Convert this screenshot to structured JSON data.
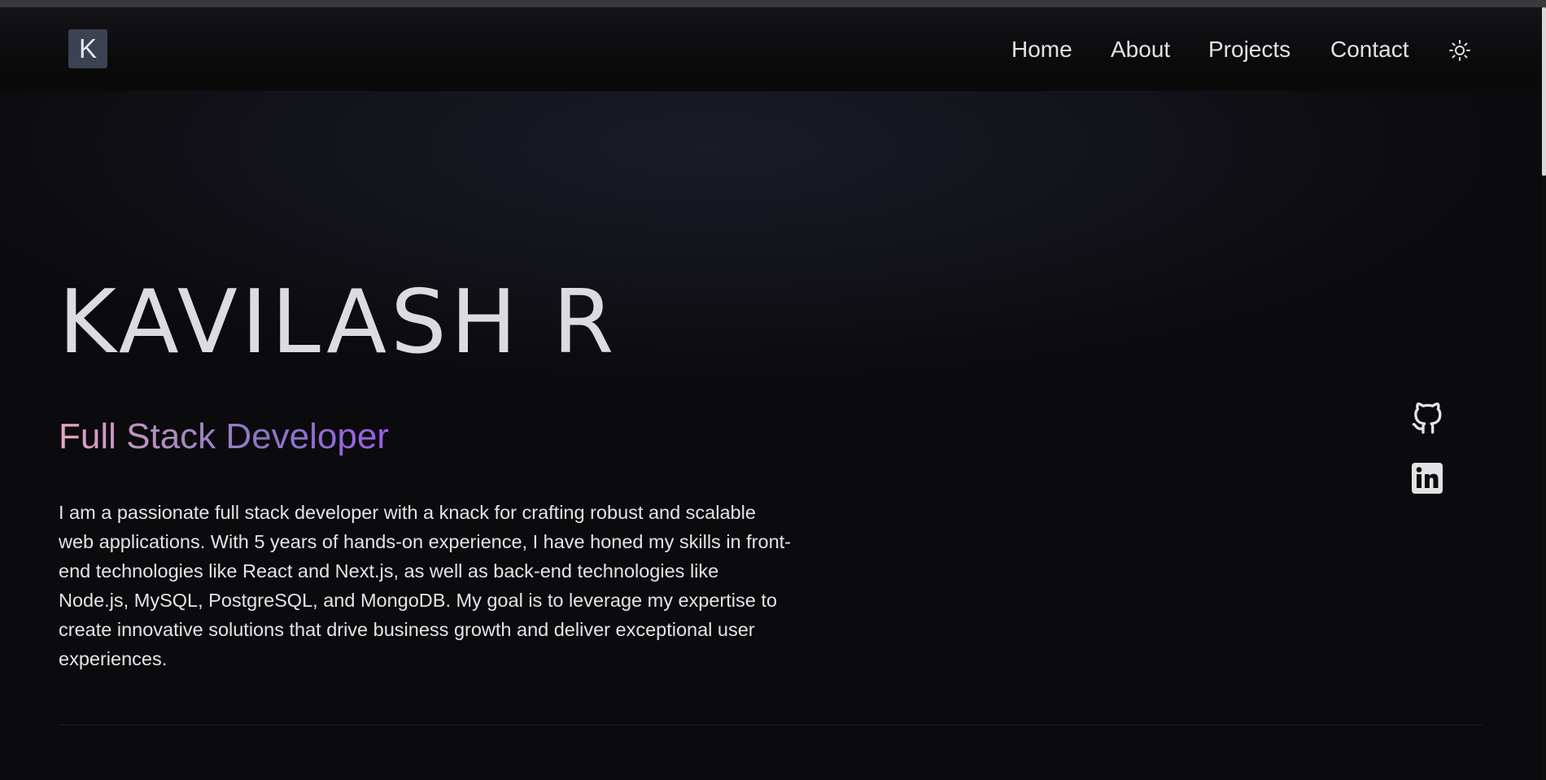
{
  "header": {
    "logo_letter": "K",
    "nav": [
      {
        "label": "Home"
      },
      {
        "label": "About"
      },
      {
        "label": "Projects"
      },
      {
        "label": "Contact"
      }
    ],
    "theme_toggle_icon": "sun-icon"
  },
  "hero": {
    "name": "KAVILASH R",
    "role": "Full Stack Developer",
    "bio": "I am a passionate full stack developer with a knack for crafting robust and scalable web applications. With 5 years of hands-on experience, I have honed my skills in front-end technologies like React and Next.js, as well as back-end technologies like Node.js, MySQL, PostgreSQL, and MongoDB. My goal is to leverage my expertise to create innovative solutions that drive business growth and deliver exceptional user experiences."
  },
  "social": [
    {
      "icon": "github-icon"
    },
    {
      "icon": "linkedin-icon"
    }
  ],
  "colors": {
    "background": "#0b0b0d",
    "logo_bg": "#3b4252",
    "role_gradient_start": "#e8a4c9",
    "role_gradient_end": "#9a5fe6",
    "text": "#e4e4e6"
  }
}
